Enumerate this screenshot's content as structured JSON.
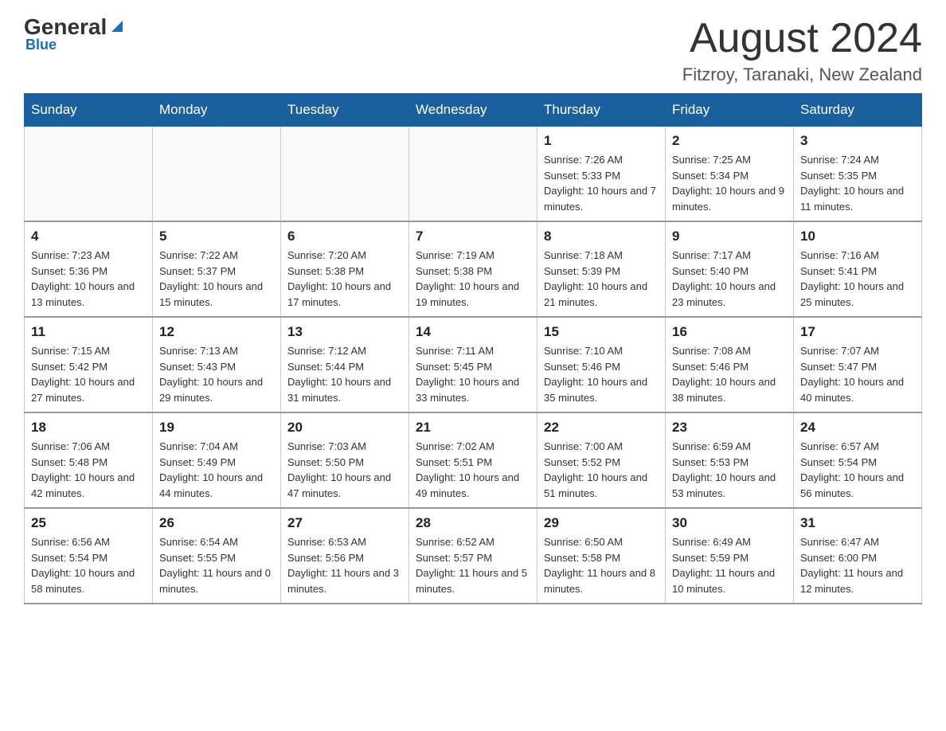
{
  "logo": {
    "brand": "General",
    "brand_blue": "Blue"
  },
  "header": {
    "title": "August 2024",
    "subtitle": "Fitzroy, Taranaki, New Zealand"
  },
  "days_of_week": [
    "Sunday",
    "Monday",
    "Tuesday",
    "Wednesday",
    "Thursday",
    "Friday",
    "Saturday"
  ],
  "weeks": [
    [
      {
        "day": "",
        "sunrise": "",
        "sunset": "",
        "daylight": ""
      },
      {
        "day": "",
        "sunrise": "",
        "sunset": "",
        "daylight": ""
      },
      {
        "day": "",
        "sunrise": "",
        "sunset": "",
        "daylight": ""
      },
      {
        "day": "",
        "sunrise": "",
        "sunset": "",
        "daylight": ""
      },
      {
        "day": "1",
        "sunrise": "Sunrise: 7:26 AM",
        "sunset": "Sunset: 5:33 PM",
        "daylight": "Daylight: 10 hours and 7 minutes."
      },
      {
        "day": "2",
        "sunrise": "Sunrise: 7:25 AM",
        "sunset": "Sunset: 5:34 PM",
        "daylight": "Daylight: 10 hours and 9 minutes."
      },
      {
        "day": "3",
        "sunrise": "Sunrise: 7:24 AM",
        "sunset": "Sunset: 5:35 PM",
        "daylight": "Daylight: 10 hours and 11 minutes."
      }
    ],
    [
      {
        "day": "4",
        "sunrise": "Sunrise: 7:23 AM",
        "sunset": "Sunset: 5:36 PM",
        "daylight": "Daylight: 10 hours and 13 minutes."
      },
      {
        "day": "5",
        "sunrise": "Sunrise: 7:22 AM",
        "sunset": "Sunset: 5:37 PM",
        "daylight": "Daylight: 10 hours and 15 minutes."
      },
      {
        "day": "6",
        "sunrise": "Sunrise: 7:20 AM",
        "sunset": "Sunset: 5:38 PM",
        "daylight": "Daylight: 10 hours and 17 minutes."
      },
      {
        "day": "7",
        "sunrise": "Sunrise: 7:19 AM",
        "sunset": "Sunset: 5:38 PM",
        "daylight": "Daylight: 10 hours and 19 minutes."
      },
      {
        "day": "8",
        "sunrise": "Sunrise: 7:18 AM",
        "sunset": "Sunset: 5:39 PM",
        "daylight": "Daylight: 10 hours and 21 minutes."
      },
      {
        "day": "9",
        "sunrise": "Sunrise: 7:17 AM",
        "sunset": "Sunset: 5:40 PM",
        "daylight": "Daylight: 10 hours and 23 minutes."
      },
      {
        "day": "10",
        "sunrise": "Sunrise: 7:16 AM",
        "sunset": "Sunset: 5:41 PM",
        "daylight": "Daylight: 10 hours and 25 minutes."
      }
    ],
    [
      {
        "day": "11",
        "sunrise": "Sunrise: 7:15 AM",
        "sunset": "Sunset: 5:42 PM",
        "daylight": "Daylight: 10 hours and 27 minutes."
      },
      {
        "day": "12",
        "sunrise": "Sunrise: 7:13 AM",
        "sunset": "Sunset: 5:43 PM",
        "daylight": "Daylight: 10 hours and 29 minutes."
      },
      {
        "day": "13",
        "sunrise": "Sunrise: 7:12 AM",
        "sunset": "Sunset: 5:44 PM",
        "daylight": "Daylight: 10 hours and 31 minutes."
      },
      {
        "day": "14",
        "sunrise": "Sunrise: 7:11 AM",
        "sunset": "Sunset: 5:45 PM",
        "daylight": "Daylight: 10 hours and 33 minutes."
      },
      {
        "day": "15",
        "sunrise": "Sunrise: 7:10 AM",
        "sunset": "Sunset: 5:46 PM",
        "daylight": "Daylight: 10 hours and 35 minutes."
      },
      {
        "day": "16",
        "sunrise": "Sunrise: 7:08 AM",
        "sunset": "Sunset: 5:46 PM",
        "daylight": "Daylight: 10 hours and 38 minutes."
      },
      {
        "day": "17",
        "sunrise": "Sunrise: 7:07 AM",
        "sunset": "Sunset: 5:47 PM",
        "daylight": "Daylight: 10 hours and 40 minutes."
      }
    ],
    [
      {
        "day": "18",
        "sunrise": "Sunrise: 7:06 AM",
        "sunset": "Sunset: 5:48 PM",
        "daylight": "Daylight: 10 hours and 42 minutes."
      },
      {
        "day": "19",
        "sunrise": "Sunrise: 7:04 AM",
        "sunset": "Sunset: 5:49 PM",
        "daylight": "Daylight: 10 hours and 44 minutes."
      },
      {
        "day": "20",
        "sunrise": "Sunrise: 7:03 AM",
        "sunset": "Sunset: 5:50 PM",
        "daylight": "Daylight: 10 hours and 47 minutes."
      },
      {
        "day": "21",
        "sunrise": "Sunrise: 7:02 AM",
        "sunset": "Sunset: 5:51 PM",
        "daylight": "Daylight: 10 hours and 49 minutes."
      },
      {
        "day": "22",
        "sunrise": "Sunrise: 7:00 AM",
        "sunset": "Sunset: 5:52 PM",
        "daylight": "Daylight: 10 hours and 51 minutes."
      },
      {
        "day": "23",
        "sunrise": "Sunrise: 6:59 AM",
        "sunset": "Sunset: 5:53 PM",
        "daylight": "Daylight: 10 hours and 53 minutes."
      },
      {
        "day": "24",
        "sunrise": "Sunrise: 6:57 AM",
        "sunset": "Sunset: 5:54 PM",
        "daylight": "Daylight: 10 hours and 56 minutes."
      }
    ],
    [
      {
        "day": "25",
        "sunrise": "Sunrise: 6:56 AM",
        "sunset": "Sunset: 5:54 PM",
        "daylight": "Daylight: 10 hours and 58 minutes."
      },
      {
        "day": "26",
        "sunrise": "Sunrise: 6:54 AM",
        "sunset": "Sunset: 5:55 PM",
        "daylight": "Daylight: 11 hours and 0 minutes."
      },
      {
        "day": "27",
        "sunrise": "Sunrise: 6:53 AM",
        "sunset": "Sunset: 5:56 PM",
        "daylight": "Daylight: 11 hours and 3 minutes."
      },
      {
        "day": "28",
        "sunrise": "Sunrise: 6:52 AM",
        "sunset": "Sunset: 5:57 PM",
        "daylight": "Daylight: 11 hours and 5 minutes."
      },
      {
        "day": "29",
        "sunrise": "Sunrise: 6:50 AM",
        "sunset": "Sunset: 5:58 PM",
        "daylight": "Daylight: 11 hours and 8 minutes."
      },
      {
        "day": "30",
        "sunrise": "Sunrise: 6:49 AM",
        "sunset": "Sunset: 5:59 PM",
        "daylight": "Daylight: 11 hours and 10 minutes."
      },
      {
        "day": "31",
        "sunrise": "Sunrise: 6:47 AM",
        "sunset": "Sunset: 6:00 PM",
        "daylight": "Daylight: 11 hours and 12 minutes."
      }
    ]
  ]
}
